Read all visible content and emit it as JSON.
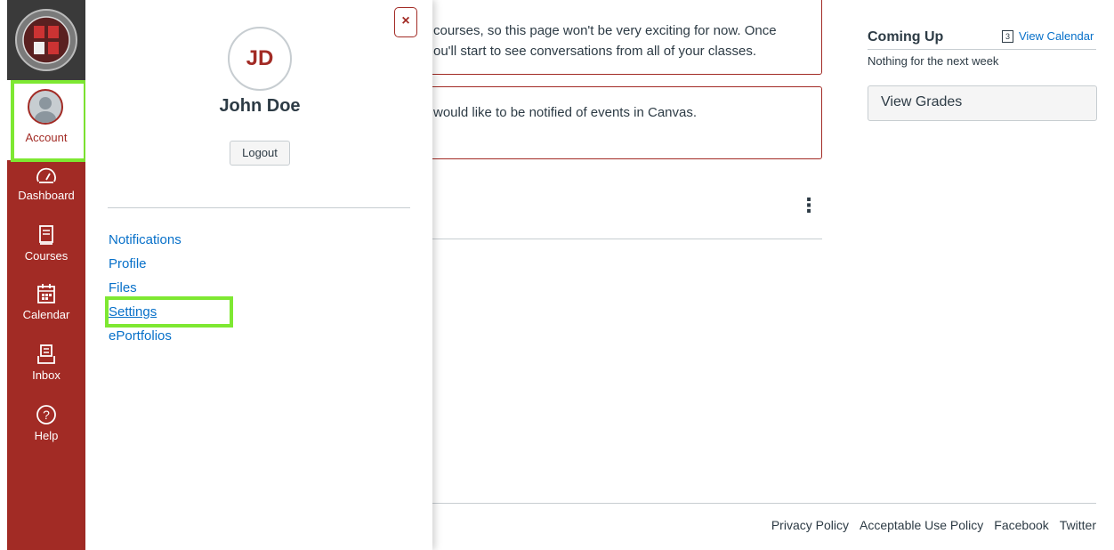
{
  "nav": {
    "account_label": "Account",
    "items": [
      {
        "label": "Dashboard",
        "icon": "dashboard-icon"
      },
      {
        "label": "Courses",
        "icon": "courses-icon"
      },
      {
        "label": "Calendar",
        "icon": "calendar-icon"
      },
      {
        "label": "Inbox",
        "icon": "inbox-icon"
      },
      {
        "label": "Help",
        "icon": "help-icon"
      }
    ]
  },
  "tray": {
    "close_label": "×",
    "initials": "JD",
    "user_name": "John Doe",
    "logout_label": "Logout",
    "links": [
      "Notifications",
      "Profile",
      "Files",
      "Settings",
      "ePortfolios"
    ]
  },
  "main": {
    "alert1_line1": "courses, so this page won't be very exciting for now. Once",
    "alert1_line2": "ou'll start to see conversations from all of your classes.",
    "alert2_text": "would like to be notified of events in Canvas.",
    "kebab": "⋮"
  },
  "sidebar": {
    "coming_up_title": "Coming Up",
    "calendar_day": "3",
    "view_calendar_label": "View Calendar",
    "nothing_text": "Nothing for the next week",
    "view_grades_label": "View Grades"
  },
  "footer": {
    "links": [
      "Privacy Policy",
      "Acceptable Use Policy",
      "Facebook",
      "Twitter"
    ]
  },
  "colors": {
    "brand": "#a22b25",
    "link": "#0770c9",
    "highlight": "#7ee832"
  }
}
